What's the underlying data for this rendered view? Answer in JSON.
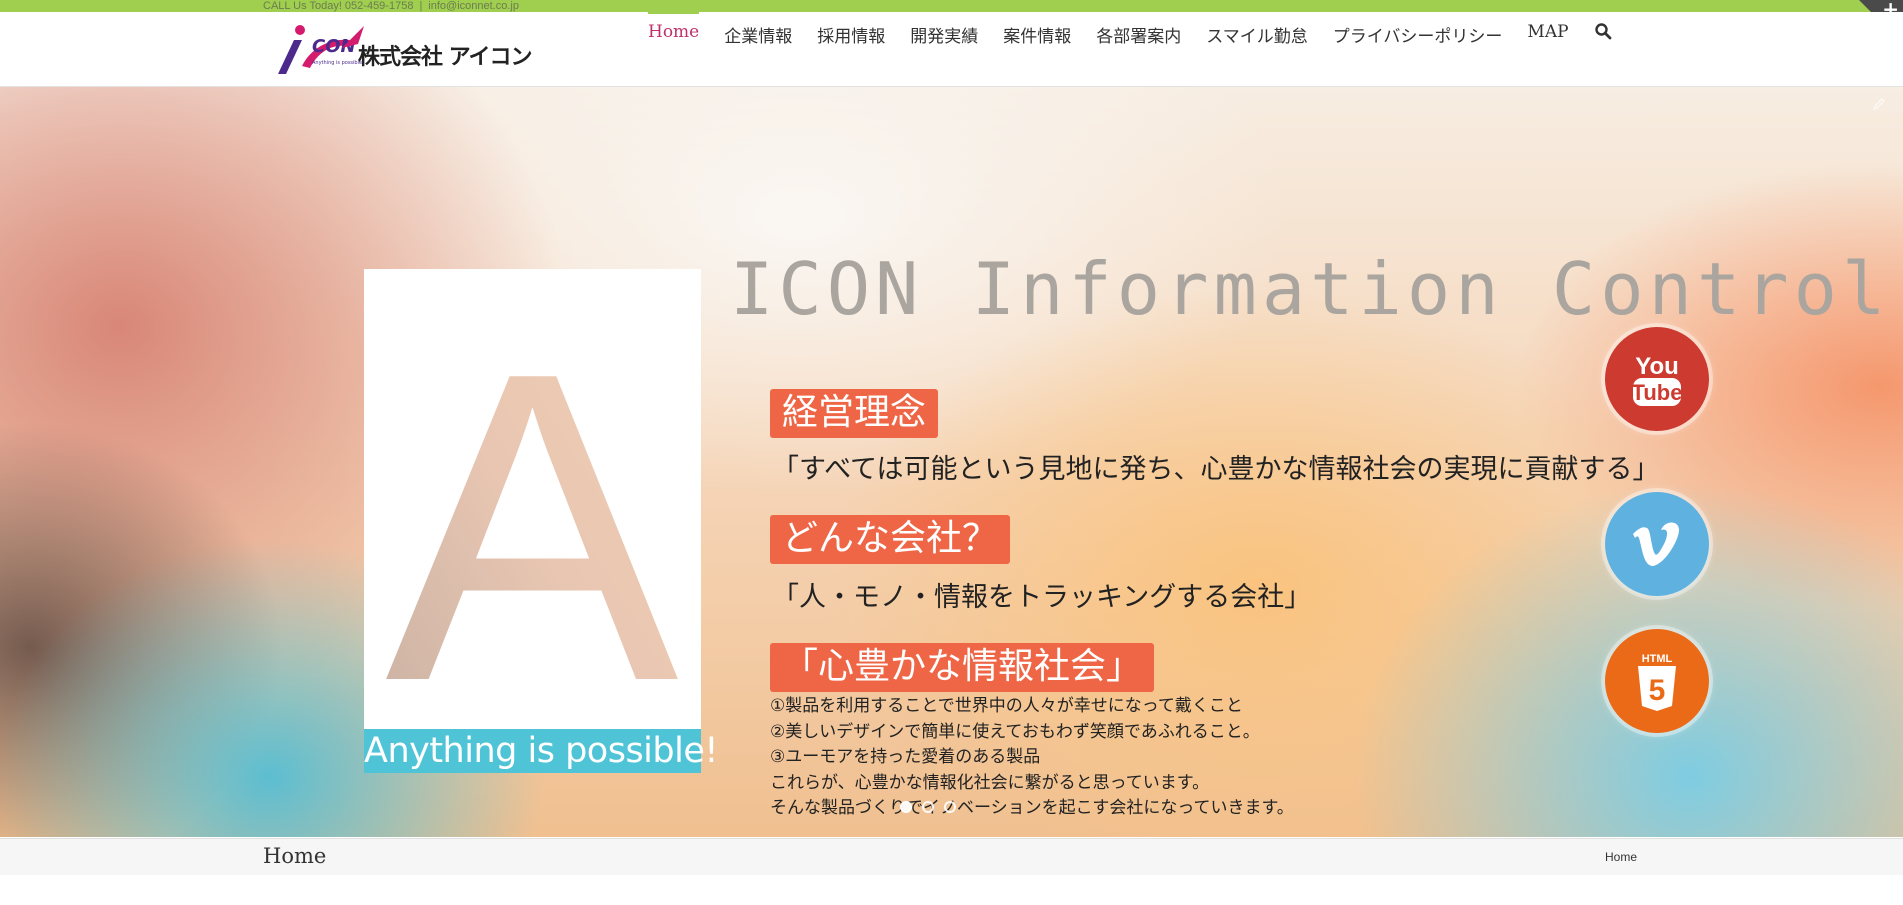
{
  "topbar": {
    "call": "CALL Us Today! 052-459-1758",
    "separator": "|",
    "email": "info@iconnet.co.jp"
  },
  "header": {
    "company_name": "株式会社 アイコン",
    "nav": [
      {
        "label": "Home",
        "active": true
      },
      {
        "label": "企業情報"
      },
      {
        "label": "採用情報"
      },
      {
        "label": "開発実績"
      },
      {
        "label": "案件情報"
      },
      {
        "label": "各部署案内"
      },
      {
        "label": "スマイル勤怠"
      },
      {
        "label": "プライバシーポリシー"
      },
      {
        "label": "MAP"
      }
    ],
    "search_icon": "search-icon"
  },
  "hero": {
    "card_letter": "A",
    "card_caption": "Anything is possible!",
    "title": "ICON Information Control",
    "tag1": "経営理念",
    "line1": "「すべては可能という見地に発ち、心豊かな情報社会の実現に貢献する」",
    "tag2": "どんな会社？",
    "line2": "「人・モノ・情報をトラッキングする会社」",
    "tag3": "「心豊かな情報社会」",
    "points": [
      "①製品を利用することで世界中の人々が幸せになって戴くこと",
      "②美しいデザインで簡単に使えておもわず笑顔であふれること。",
      "③ユーモアを持った愛着のある製品",
      "これらが、心豊かな情報化社会に繋がると思っています。",
      "そんな製品づくりでイノベーションを起こす会社になっていきます。"
    ],
    "social": [
      {
        "name": "YouTube",
        "icon": "youtube-icon"
      },
      {
        "name": "Vimeo",
        "icon": "vimeo-icon"
      },
      {
        "name": "HTML5",
        "icon": "html5-icon"
      }
    ],
    "slides": 3,
    "active_slide": 1
  },
  "titlebar": {
    "title": "Home",
    "breadcrumb": "Home"
  },
  "colors": {
    "accent_green": "#a0ce4e",
    "active_nav": "#c0306b",
    "tag_orange": "#ef6646",
    "caption_cyan": "#4ec4d6"
  }
}
